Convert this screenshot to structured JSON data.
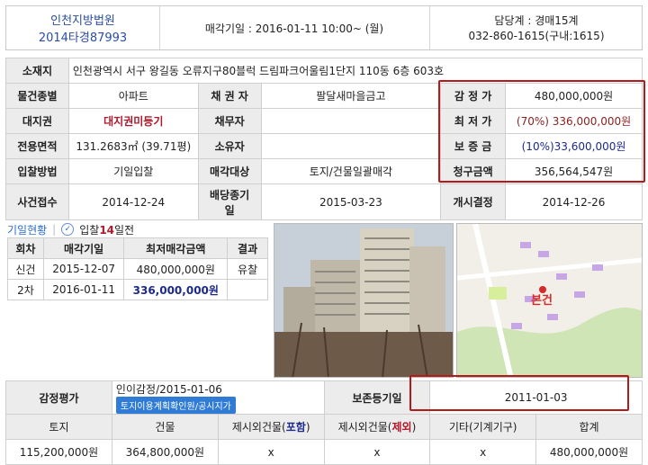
{
  "header": {
    "court": "인천지방법원",
    "case_no": "2014타경87993",
    "sale_date": "매각기일 : 2016-01-11   10:00~ (월)",
    "officer": "담당계 : 경매15계",
    "phone": "032-860-1615(구내:1615)"
  },
  "info": {
    "address_label": "소재지",
    "address": "인천광역시 서구 왕길동 오류지구80블럭 드림파크어울림1단지 110동 6층 603호",
    "type_label": "물건종별",
    "type": "아파트",
    "creditor_label": "채 권 자",
    "creditor": "팔달새마을금고",
    "appraisal_label": "감 정 가",
    "appraisal": "480,000,000원",
    "land_right_label": "대지권",
    "land_right": "대지권미등기",
    "debtor_label": "채무자",
    "debtor": "",
    "min_price_label": "최 저 가",
    "min_price": "(70%) 336,000,000원",
    "area_label": "전용면적",
    "area": "131.2683㎡ (39.71평)",
    "owner_label": "소유자",
    "owner": "",
    "deposit_label": "보 증 금",
    "deposit": "(10%)33,600,000원",
    "bid_method_label": "입찰방법",
    "bid_method": "기일입찰",
    "target_label": "매각대상",
    "target": "토지/건물일괄매각",
    "claim_label": "청구금액",
    "claim": "356,564,547원",
    "receipt_label": "사건접수",
    "receipt": "2014-12-24",
    "dividend_label": "배당종기일",
    "dividend": "2015-03-23",
    "start_label": "개시결정",
    "start": "2014-12-26"
  },
  "bidding": {
    "title": "기일현황",
    "dday_prefix": "입찰",
    "dday_num": "14",
    "dday_suffix": "일전",
    "headers": [
      "회차",
      "매각기일",
      "최저매각금액",
      "결과"
    ],
    "rows": [
      {
        "round": "신건",
        "date": "2015-12-07",
        "price": "480,000,000원",
        "result": "유찰"
      },
      {
        "round": "2차",
        "date": "2016-01-11",
        "price": "336,000,000원",
        "result": ""
      }
    ]
  },
  "map": {
    "label": "본건"
  },
  "appraisal_detail": {
    "label": "감정평가",
    "value": "인이감정/2015-01-06",
    "button": "토지이용계획확인원/공시지가",
    "reg_label": "보존등기일",
    "reg_date": "2011-01-03",
    "headers": [
      "토지",
      "건물",
      "제시외건물(포함)",
      "제시외건물(제외)",
      "기타(기계기구)",
      "합계"
    ],
    "header_parts": {
      "incl_a": "제시외건물(",
      "incl_b": "포함",
      "incl_c": ")",
      "excl_a": "제시외건물(",
      "excl_b": "제외",
      "excl_c": ")"
    },
    "values": [
      "115,200,000원",
      "364,800,000원",
      "x",
      "x",
      "x",
      "480,000,000원"
    ]
  }
}
